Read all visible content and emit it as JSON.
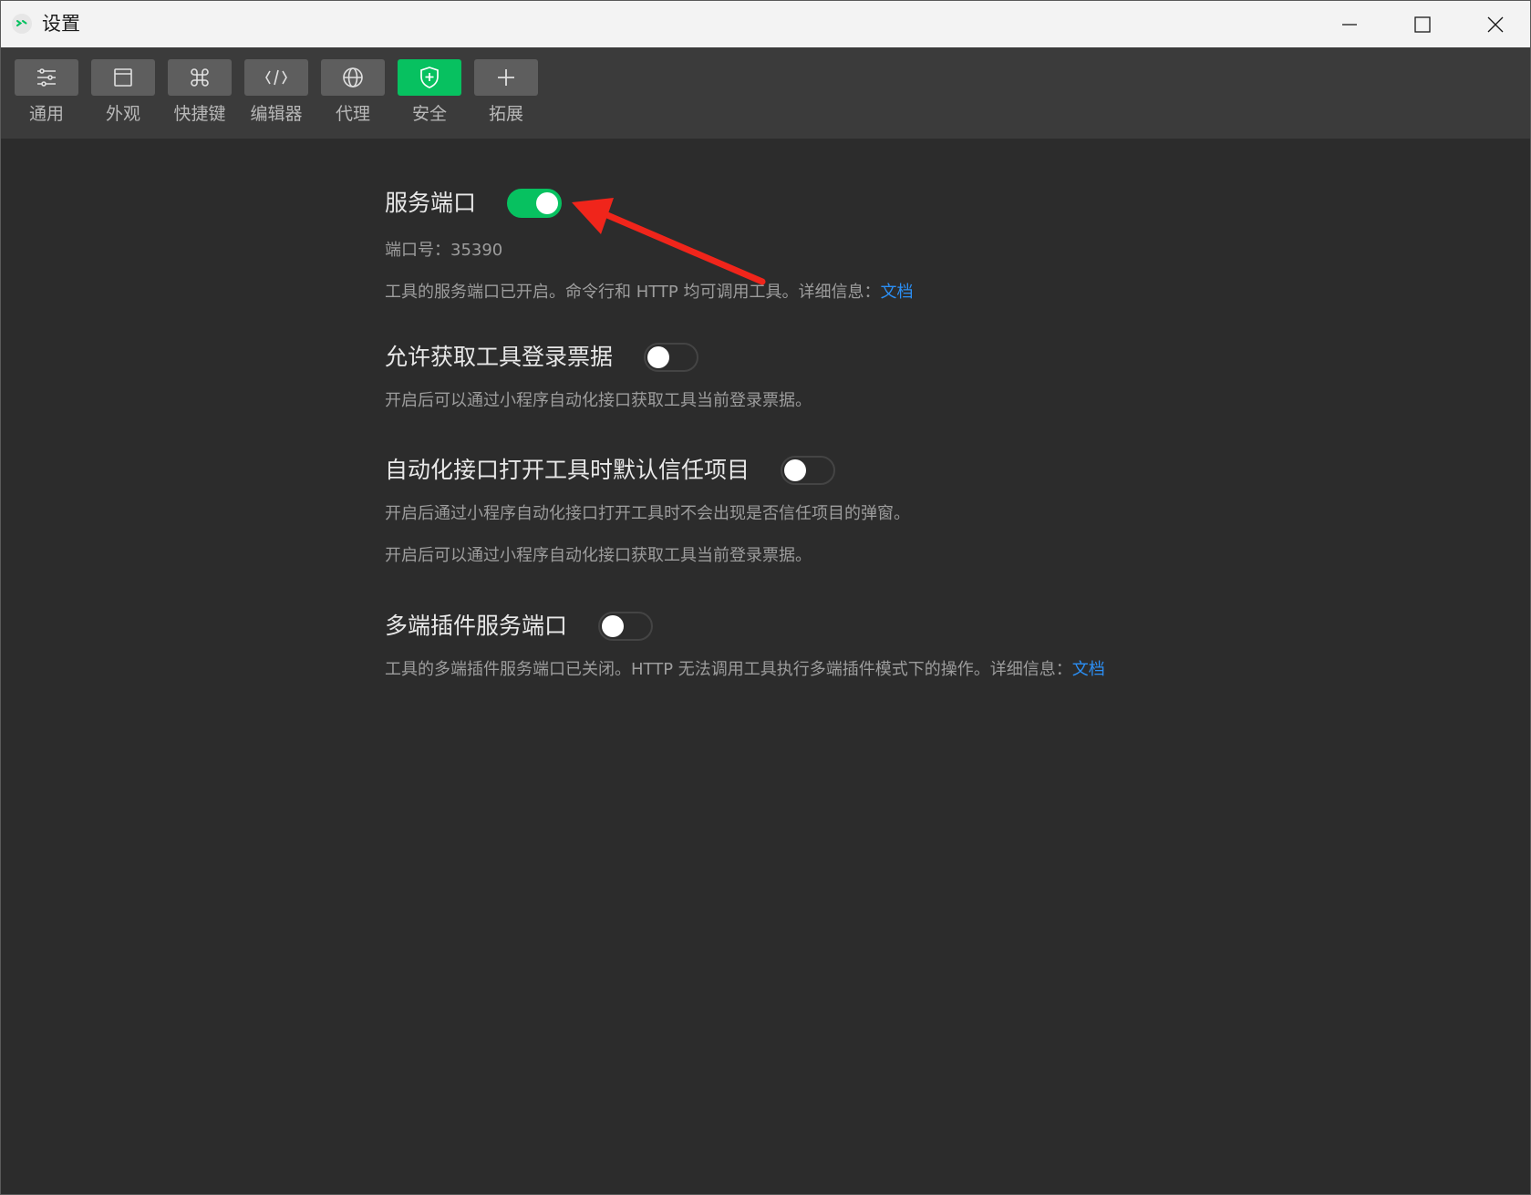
{
  "window": {
    "title": "设置"
  },
  "toolbar": {
    "items": [
      {
        "label": "通用",
        "icon": "sliders-icon"
      },
      {
        "label": "外观",
        "icon": "window-layout-icon"
      },
      {
        "label": "快捷键",
        "icon": "command-key-icon"
      },
      {
        "label": "编辑器",
        "icon": "code-icon"
      },
      {
        "label": "代理",
        "icon": "globe-icon"
      },
      {
        "label": "安全",
        "icon": "shield-icon",
        "active": true
      },
      {
        "label": "拓展",
        "icon": "plus-icon"
      }
    ],
    "active_color": "#07c160"
  },
  "security": {
    "service_port": {
      "title": "服务端口",
      "enabled": true,
      "port_line": "端口号：35390",
      "desc_text": "工具的服务端口已开启。命令行和 HTTP 均可调用工具。详细信息：",
      "link_label": "文档"
    },
    "login_ticket": {
      "title": "允许获取工具登录票据",
      "enabled": false,
      "desc": "开启后可以通过小程序自动化接口获取工具当前登录票据。"
    },
    "auto_trust": {
      "title": "自动化接口打开工具时默认信任项目",
      "enabled": false,
      "desc1": "开启后通过小程序自动化接口打开工具时不会出现是否信任项目的弹窗。",
      "desc2": "开启后可以通过小程序自动化接口获取工具当前登录票据。"
    },
    "multi_plugin": {
      "title": "多端插件服务端口",
      "enabled": false,
      "desc_text": "工具的多端插件服务端口已关闭。HTTP 无法调用工具执行多端插件模式下的操作。详细信息：",
      "link_label": "文档"
    }
  },
  "annotation": {
    "arrow_color": "#f0251b"
  }
}
